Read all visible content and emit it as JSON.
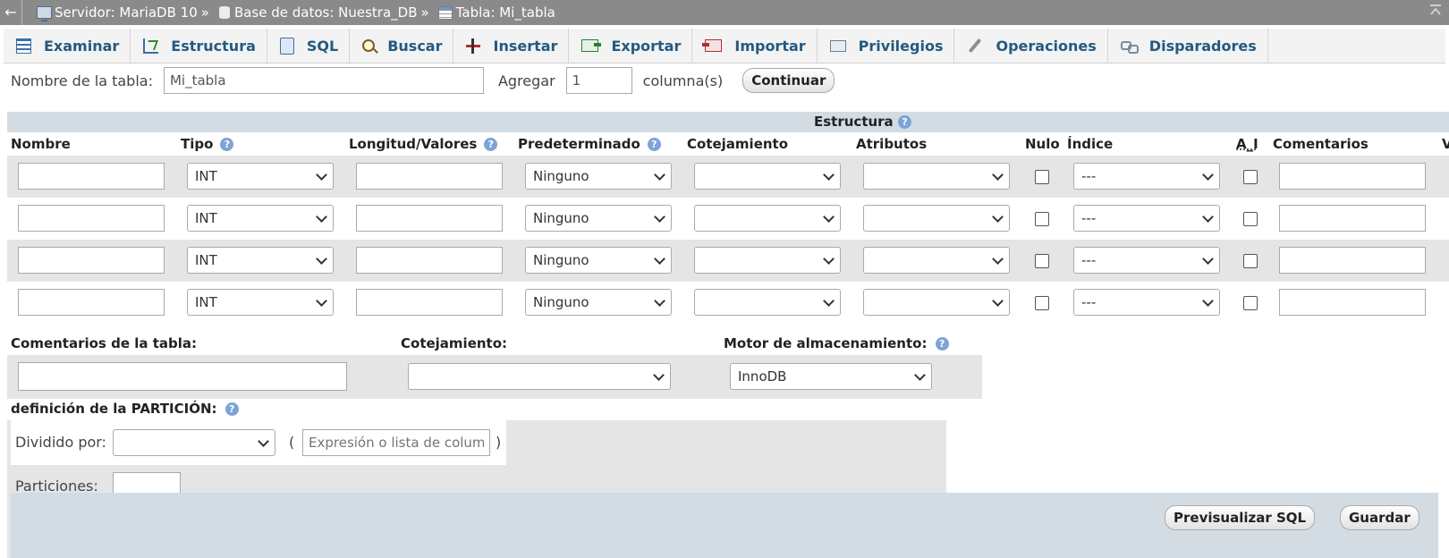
{
  "breadcrumb": {
    "back": "←",
    "server": "Servidor: MariaDB 10",
    "database": "Base de datos: Nuestra_DB",
    "table": "Tabla: Mi_tabla",
    "separator": "»"
  },
  "tabs": [
    {
      "label": "Examinar",
      "icon": "browse-icon"
    },
    {
      "label": "Estructura",
      "icon": "structure-icon"
    },
    {
      "label": "SQL",
      "icon": "sql-icon"
    },
    {
      "label": "Buscar",
      "icon": "search-icon"
    },
    {
      "label": "Insertar",
      "icon": "insert-icon"
    },
    {
      "label": "Exportar",
      "icon": "export-icon"
    },
    {
      "label": "Importar",
      "icon": "import-icon"
    },
    {
      "label": "Privilegios",
      "icon": "privileges-icon"
    },
    {
      "label": "Operaciones",
      "icon": "wrench-icon"
    },
    {
      "label": "Disparadores",
      "icon": "triggers-icon"
    }
  ],
  "table_name": {
    "label": "Nombre de la tabla:",
    "value": "Mi_tabla",
    "add_label": "Agregar",
    "add_value": "1",
    "columns_label": "columna(s)",
    "continue_button": "Continuar"
  },
  "structure": {
    "title": "Estructura",
    "columns": [
      "Nombre",
      "Tipo",
      "Longitud/Valores",
      "Predeterminado",
      "Cotejamiento",
      "Atributos",
      "Nulo",
      "Índice",
      "A_I",
      "Comentarios",
      "V"
    ],
    "rows": [
      {
        "name": "",
        "type": "INT",
        "length": "",
        "default": "Ninguno",
        "collation": "",
        "attributes": "",
        "null": false,
        "index": "---",
        "ai": false,
        "comments": ""
      },
      {
        "name": "",
        "type": "INT",
        "length": "",
        "default": "Ninguno",
        "collation": "",
        "attributes": "",
        "null": false,
        "index": "---",
        "ai": false,
        "comments": ""
      },
      {
        "name": "",
        "type": "INT",
        "length": "",
        "default": "Ninguno",
        "collation": "",
        "attributes": "",
        "null": false,
        "index": "---",
        "ai": false,
        "comments": ""
      },
      {
        "name": "",
        "type": "INT",
        "length": "",
        "default": "Ninguno",
        "collation": "",
        "attributes": "",
        "null": false,
        "index": "---",
        "ai": false,
        "comments": ""
      }
    ]
  },
  "table_options": {
    "comments_label": "Comentarios de la tabla:",
    "comments_value": "",
    "collation_label": "Cotejamiento:",
    "collation_value": "",
    "engine_label": "Motor de almacenamiento:",
    "engine_value": "InnoDB"
  },
  "partition": {
    "label": "definición de la PARTICIÓN:",
    "divided_by_label": "Dividido por:",
    "divided_by_value": "",
    "open_paren": "(",
    "expression_placeholder": "Expresión o lista de columnas",
    "close_paren": ")",
    "partitions_label": "Particiones:",
    "partitions_value": ""
  },
  "footer": {
    "preview_button": "Previsualizar SQL",
    "save_button": "Guardar"
  },
  "help_glyph": "?"
}
